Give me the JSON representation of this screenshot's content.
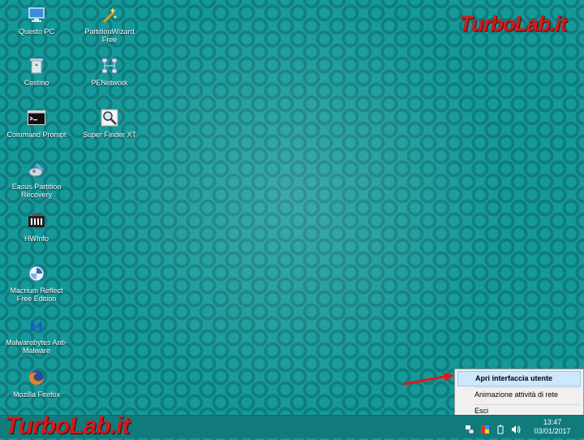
{
  "desktop": {
    "icons": [
      {
        "label": "Questo PC",
        "icon": "computer-icon"
      },
      {
        "label": "PartitionWizard Free",
        "icon": "partition-wizard-icon"
      },
      {
        "label": "Cestino",
        "icon": "recycle-bin-icon"
      },
      {
        "label": "PENetwork",
        "icon": "network-icon"
      },
      {
        "label": "Command Prompt",
        "icon": "command-prompt-icon"
      },
      {
        "label": "Super Finder XT",
        "icon": "magnifier-icon"
      },
      {
        "label": "Easus Partition Recovery",
        "icon": "partition-recovery-icon"
      },
      {
        "label": "HWInfo",
        "icon": "hwinfo-icon"
      },
      {
        "label": "Macrium Reflect Free Edition",
        "icon": "macrium-reflect-icon"
      },
      {
        "label": "Malwarebytes Anti-Malware",
        "icon": "malwarebytes-icon"
      },
      {
        "label": "Mozilla Firefox",
        "icon": "firefox-icon"
      }
    ]
  },
  "watermark": {
    "top": "TurboLab.it",
    "bottom": "TurboLab.it"
  },
  "context_menu": {
    "items": [
      {
        "label": "Apri interfaccia utente",
        "highlighted": true
      },
      {
        "label": "Animazione attività di rete",
        "highlighted": false
      },
      {
        "label": "Esci",
        "highlighted": false
      }
    ]
  },
  "taskbar": {
    "tray_icons": [
      "network-icon",
      "color-icon",
      "battery-icon",
      "volume-icon"
    ],
    "time": "13:47",
    "date": "03/01/2017"
  },
  "colors": {
    "desktop_background": "#159a9b",
    "taskbar": "#117b7c",
    "menu_highlight": "#cce8ff",
    "logo_red": "#d11b1b"
  }
}
